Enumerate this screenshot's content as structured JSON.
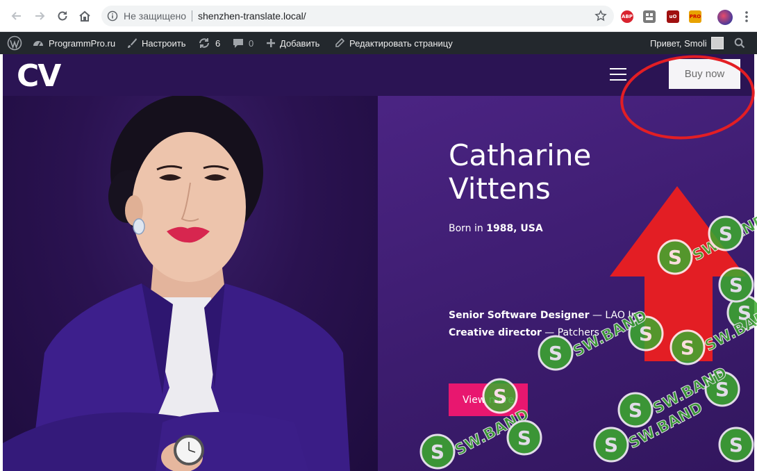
{
  "browser": {
    "security_text": "Не защищено",
    "url": "shenzhen-translate.local/",
    "extensions": [
      {
        "name": "adblock-plus",
        "label": "ABP",
        "color": "#d9232e"
      },
      {
        "name": "extension",
        "label": "",
        "color": "#7a7a7a"
      },
      {
        "name": "ublock-origin",
        "label": "uO",
        "color": "#a01010"
      },
      {
        "name": "pro-extension",
        "label": "PRO",
        "color": "#e8a200"
      }
    ]
  },
  "admin_bar": {
    "site_name": "ProgrammPro.ru",
    "customize": "Настроить",
    "updates_count": "6",
    "comments_count": "0",
    "add_new": "Добавить",
    "edit_page": "Редактировать страницу",
    "greeting": "Привет, Smoli"
  },
  "site": {
    "logo": "CV",
    "buy_label": "Buy now",
    "name_line1": "Catharine",
    "name_line2": "Vittens",
    "born_prefix": "Born in ",
    "born_value": "1988, USA",
    "role1_title": "Senior Software Designer",
    "role1_company": " — LAO Inc.",
    "role2_title": "Creative director",
    "role2_company": " — Patchers",
    "view_more": "View more"
  },
  "watermark": {
    "text": "SW.BAND"
  },
  "colors": {
    "site_bg": "#2e1558",
    "accent_pink": "#e8176f",
    "annotation_red": "#e31e24",
    "watermark_green": "#3cab2e",
    "admin_bar": "#23282d"
  }
}
